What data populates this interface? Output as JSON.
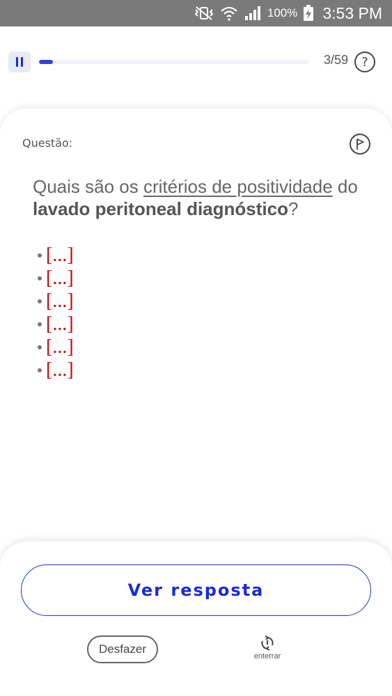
{
  "status_bar": {
    "battery": "100%",
    "time": "3:53 PM",
    "icons": [
      "mute-vibrate-icon",
      "wifi-icon",
      "signal-icon",
      "battery-charging-icon"
    ]
  },
  "progress": {
    "current": 3,
    "total": 59,
    "label": "3/59",
    "fraction": 0.051,
    "accent_color": "#3440e0"
  },
  "question": {
    "label": "Questão:",
    "text_parts": {
      "p1": "Quais são os ",
      "p2": "critérios de positividade",
      "p3": " do ",
      "p4": "lavado peritoneal diagnóstico",
      "p5": "?"
    },
    "cloze_items": [
      "[...]",
      "[...]",
      "[...]",
      "[...]",
      "[...]",
      "[...]"
    ],
    "cloze_color": "#d40000"
  },
  "actions": {
    "reveal_label": "Ver resposta",
    "undo_label": "Desfazer",
    "bury_label": "enterrar"
  }
}
